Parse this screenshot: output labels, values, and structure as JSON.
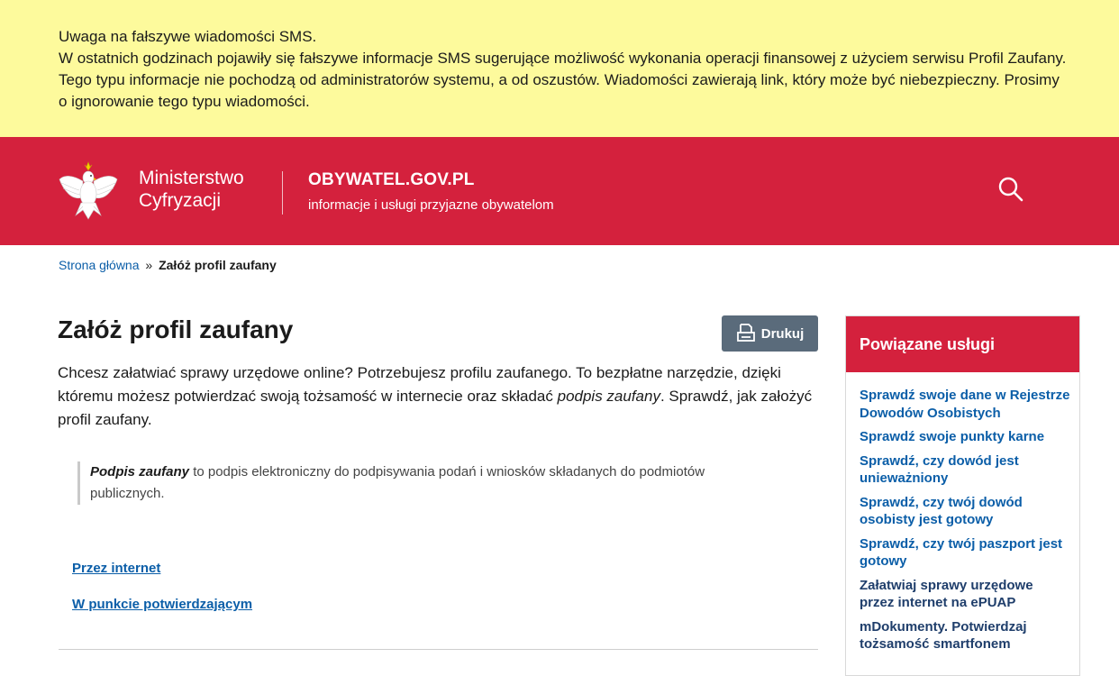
{
  "alert": {
    "title": "Uwaga na fałszywe wiadomości SMS.",
    "body": "W ostatnich godzinach pojawiły się fałszywe informacje SMS sugerujące możliwość wykonania operacji finansowej z użyciem serwisu Profil Zaufany. Tego typu informacje nie pochodzą od administratorów systemu, a od oszustów. Wiadomości zawierają link, który może być niebezpieczny. Prosimy o ignorowanie tego typu wiadomości."
  },
  "header": {
    "ministry_line1": "Ministerstwo",
    "ministry_line2": "Cyfryzacji",
    "site_name": "OBYWATEL.GOV.PL",
    "site_tagline": "informacje i usługi przyjazne obywatelom",
    "brand_color": "#d4213d",
    "search_icon": "search-icon"
  },
  "breadcrumb": {
    "home": "Strona główna",
    "separator": "»",
    "current": "Załóż profil zaufany"
  },
  "main": {
    "title": "Załóż profil zaufany",
    "print_label": "Drukuj",
    "intro_part1": "Chcesz załatwiać sprawy urzędowe online? Potrzebujesz profilu zaufanego. To bezpłatne narzędzie, dzięki któremu możesz potwierdzać swoją tożsamość w internecie oraz składać ",
    "intro_em": "podpis zaufany",
    "intro_part2": ". Sprawdź, jak założyć profil zaufany.",
    "quote_strong": "Podpis zaufany",
    "quote_rest": " to podpis elektroniczny do podpisywania podań i wniosków składanych do podmiotów publicznych.",
    "links": [
      "Przez internet",
      "W punkcie potwierdzającym"
    ]
  },
  "related": {
    "title": "Powiązane usługi",
    "items": [
      "Sprawdź swoje dane w Rejestrze Dowodów Osobistych",
      "Sprawdź swoje punkty karne",
      "Sprawdź, czy dowód jest unieważniony",
      "Sprawdź, czy twój dowód osobisty jest gotowy",
      "Sprawdź, czy twój paszport jest gotowy",
      "Załatwiaj sprawy urzędowe przez internet na ePUAP",
      "mDokumenty. Potwierdzaj tożsamość smartfonem"
    ]
  }
}
